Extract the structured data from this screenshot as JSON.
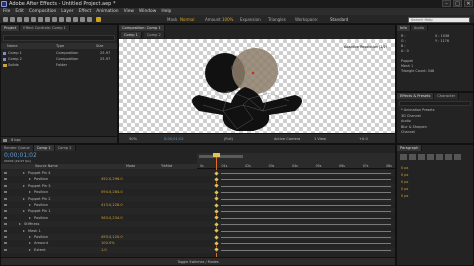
{
  "app": {
    "title": "Adobe After Effects - Untitled Project.aep *",
    "window_controls": [
      "–",
      "□",
      "✕"
    ]
  },
  "menu": [
    "File",
    "Edit",
    "Composition",
    "Layer",
    "Effect",
    "Animation",
    "View",
    "Window",
    "Help"
  ],
  "toolbar": {
    "mask_label": "Mask",
    "mask_value": "Normal",
    "amount_label": "Amount",
    "amount_value": "100%",
    "expansion_label": "Expansion",
    "triangles_label": "Triangles",
    "workspace_label": "Workspace:",
    "workspace_value": "Standard",
    "search_placeholder": "Search Help"
  },
  "project": {
    "tab": "Project",
    "effect_tab": "Effect Controls: Comp 1",
    "header_name": "Name",
    "header_type": "Type",
    "header_size": "Size",
    "items": [
      {
        "name": "Comp 1",
        "type": "Composition",
        "size": "25.97"
      },
      {
        "name": "Comp 2",
        "type": "Composition",
        "size": "25.97"
      },
      {
        "name": "Solids",
        "type": "Folder",
        "size": ""
      }
    ],
    "bpc": "8 bpc"
  },
  "comp": {
    "tab": "Composition: Comp 1",
    "subtabs": [
      "Comp 1",
      "Comp 2"
    ],
    "overlay_text": "Adaptive Resolution (1/2)",
    "zoom": "50%",
    "timecode": "0;00;01;02",
    "resolution": "(Full)",
    "camera": "Active Camera",
    "view": "1 View",
    "offset": "+0.0"
  },
  "info": {
    "tab": "Info",
    "audio_tab": "Audio",
    "r": "R :",
    "g": "G :",
    "b": "B :",
    "a": "A : 0",
    "x": "X : 1036",
    "y": "Y : 1176",
    "puppet": "Puppet",
    "mesh": "Mesh 1",
    "triangle_count": "Triangle Count: 348"
  },
  "effects": {
    "tab": "Effects & Presets",
    "char_tab": "Character",
    "items": [
      "* Animation Presets",
      "3D Channel",
      "Audio",
      "Blur & Sharpen",
      "Channel"
    ]
  },
  "timeline": {
    "tabs": [
      "Render Queue",
      "Comp 1",
      "Comp 2"
    ],
    "timecode": "0;00;01;02",
    "frames": "00032 (29.97 fps)",
    "col_source": "Source Name",
    "col_mode": "Mode",
    "col_trkmat": "TrkMat",
    "ruler": [
      "0s",
      "01s",
      "02s",
      "03s",
      "04s",
      "05s",
      "06s",
      "07s",
      "08s"
    ],
    "footer": "Toggle Switches / Modes",
    "rows": [
      {
        "label": "Puppet Pin 4",
        "value": "",
        "indent": 14
      },
      {
        "label": "Position",
        "value": "452.0,296.0",
        "indent": 20
      },
      {
        "label": "Puppet Pin 3",
        "value": "",
        "indent": 14
      },
      {
        "label": "Position",
        "value": "594.0,284.0",
        "indent": 20
      },
      {
        "label": "Puppet Pin 2",
        "value": "",
        "indent": 14
      },
      {
        "label": "Position",
        "value": "413.0,228.0",
        "indent": 20
      },
      {
        "label": "Puppet Pin 1",
        "value": "",
        "indent": 14
      },
      {
        "label": "Position",
        "value": "563.0,234.0",
        "indent": 20
      },
      {
        "label": "Stiffness",
        "value": "",
        "indent": 10
      },
      {
        "label": "Mesh 1",
        "value": "",
        "indent": 14
      },
      {
        "label": "Position",
        "value": "493.0,120.0",
        "indent": 20
      },
      {
        "label": "Amount",
        "value": "100.0%",
        "indent": 20
      },
      {
        "label": "Extent",
        "value": "1.0",
        "indent": 20
      }
    ]
  },
  "paragraph": {
    "tab": "Paragraph",
    "fields": [
      "0 px",
      "0 px",
      "0 px",
      "0 px",
      "0 px"
    ]
  }
}
